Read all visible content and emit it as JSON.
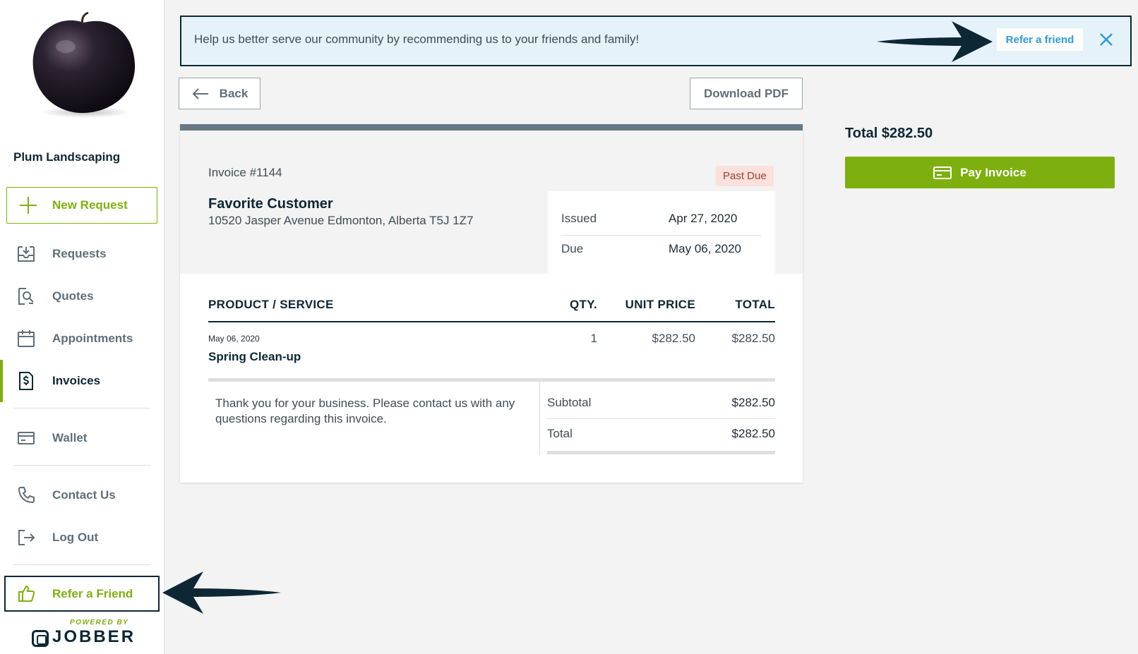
{
  "sidebar": {
    "company": "Plum Landscaping",
    "new_request": "New Request",
    "items": [
      {
        "label": "Requests",
        "icon": "inbox-icon"
      },
      {
        "label": "Quotes",
        "icon": "search-doc-icon"
      },
      {
        "label": "Appointments",
        "icon": "calendar-icon"
      },
      {
        "label": "Invoices",
        "icon": "dollar-doc-icon"
      },
      {
        "label": "Wallet",
        "icon": "credit-card-icon"
      },
      {
        "label": "Contact Us",
        "icon": "phone-icon"
      },
      {
        "label": "Log Out",
        "icon": "logout-icon"
      }
    ],
    "active": "Invoices",
    "refer": "Refer a Friend",
    "powered_by": "POWERED BY",
    "brand": "JOBBER"
  },
  "banner": {
    "message": "Help us better serve our community by recommending us to your friends and family!",
    "refer_link": "Refer a friend"
  },
  "toolbar": {
    "back": "Back",
    "download": "Download PDF"
  },
  "invoice": {
    "number": "Invoice #1144",
    "status": "Past Due",
    "customer": "Favorite Customer",
    "address": "10520 Jasper Avenue Edmonton, Alberta T5J 1Z7",
    "issued_label": "Issued",
    "issued": "Apr 27, 2020",
    "due_label": "Due",
    "due": "May 06, 2020",
    "columns": [
      "PRODUCT / SERVICE",
      "QTY.",
      "UNIT PRICE",
      "TOTAL"
    ],
    "line_items": [
      {
        "date": "May 06, 2020",
        "name": "Spring Clean-up",
        "qty": "1",
        "unit_price": "$282.50",
        "total": "$282.50"
      }
    ],
    "note": "Thank you for your business. Please contact us with any questions regarding this invoice.",
    "subtotal_label": "Subtotal",
    "subtotal": "$282.50",
    "total_label": "Total",
    "total": "$282.50"
  },
  "summary": {
    "total": "Total $282.50",
    "pay": "Pay Invoice"
  },
  "colors": {
    "brand_green": "#7db00e",
    "navy": "#0d2735",
    "link_blue": "#2e9bd6",
    "banner_bg": "#e5f2fa",
    "past_due_bg": "#fbe0dc"
  }
}
